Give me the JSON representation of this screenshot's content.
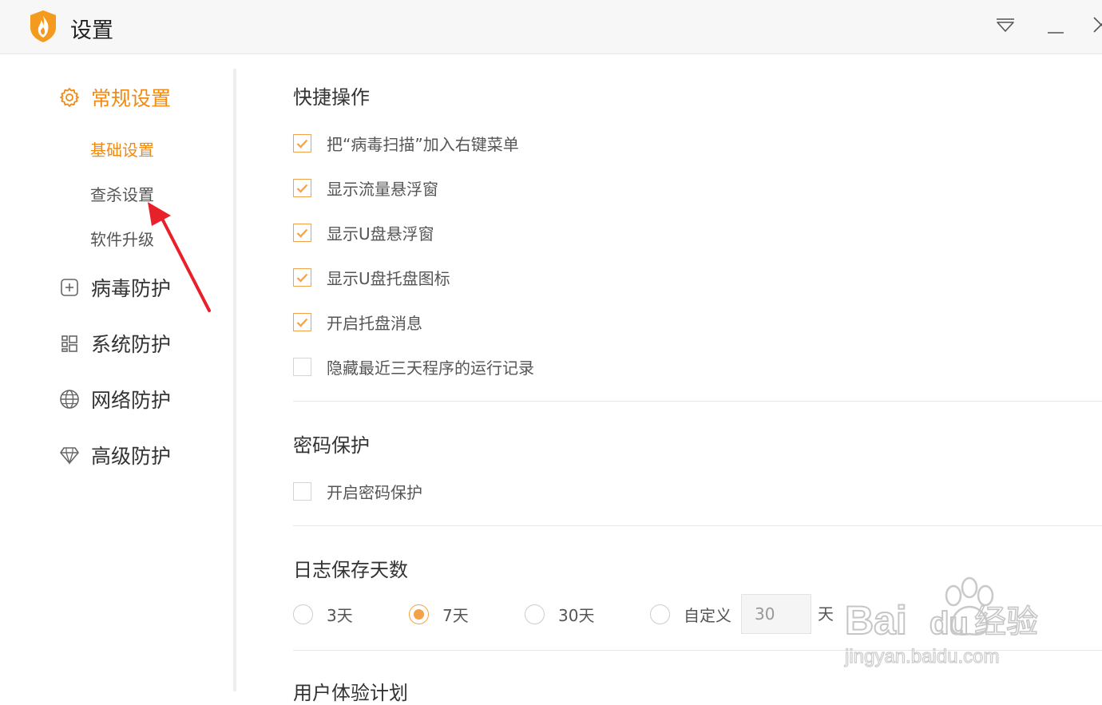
{
  "app": {
    "title": "设置"
  },
  "colors": {
    "accent": "#f08a13",
    "checkbox": "#f4a24a"
  },
  "sidebar": {
    "groups": [
      {
        "label": "常规设置",
        "icon": "gear-icon",
        "active": true
      },
      {
        "label": "病毒防护",
        "icon": "plus-square-icon"
      },
      {
        "label": "系统防护",
        "icon": "windows-icon"
      },
      {
        "label": "网络防护",
        "icon": "globe-icon"
      },
      {
        "label": "高级防护",
        "icon": "diamond-icon"
      }
    ],
    "subitems": [
      {
        "label": "基础设置",
        "active": true
      },
      {
        "label": "查杀设置"
      },
      {
        "label": "软件升级"
      }
    ]
  },
  "sections": {
    "shortcut": {
      "title": "快捷操作",
      "options": [
        {
          "label": "把“病毒扫描”加入右键菜单",
          "checked": true
        },
        {
          "label": "显示流量悬浮窗",
          "checked": true
        },
        {
          "label": "显示U盘悬浮窗",
          "checked": true
        },
        {
          "label": "显示U盘托盘图标",
          "checked": true
        },
        {
          "label": "开启托盘消息",
          "checked": true
        },
        {
          "label": "隐藏最近三天程序的运行记录",
          "checked": false
        }
      ]
    },
    "password": {
      "title": "密码保护",
      "options": [
        {
          "label": "开启密码保护",
          "checked": false
        }
      ]
    },
    "log": {
      "title": "日志保存天数",
      "radios": [
        {
          "label": "3天",
          "checked": false
        },
        {
          "label": "7天",
          "checked": true
        },
        {
          "label": "30天",
          "checked": false
        },
        {
          "label": "自定义",
          "checked": false
        }
      ],
      "custom_value": "30",
      "unit": "天"
    },
    "experience": {
      "title": "用户体验计划"
    }
  },
  "watermark": {
    "brand": "Bai",
    "brand2": "du",
    "cn": "经验",
    "url": "jingyan.baidu.com"
  }
}
